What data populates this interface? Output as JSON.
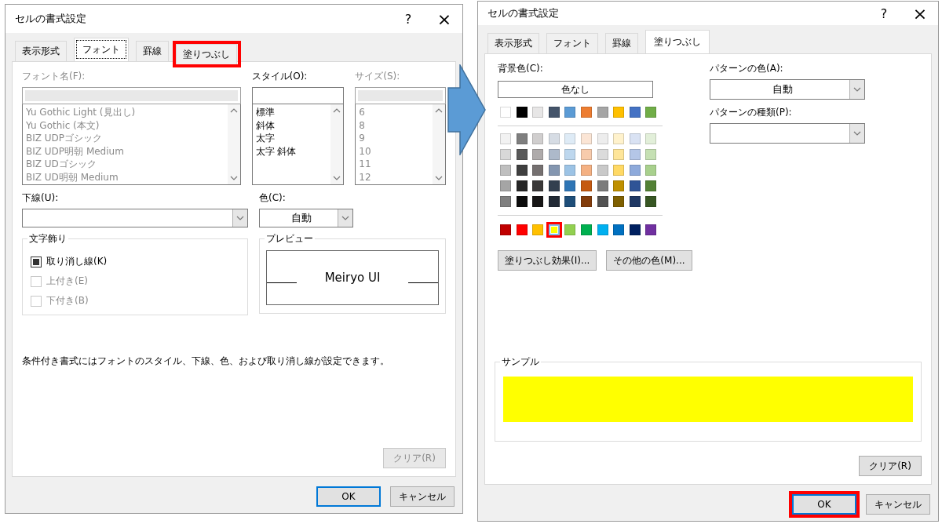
{
  "left_dialog": {
    "title": "セルの書式設定",
    "help": "?",
    "close": "×",
    "tabs": [
      {
        "label": "表示形式",
        "selected": false,
        "highlighted": false
      },
      {
        "label": "フォント",
        "selected": true,
        "highlighted": false
      },
      {
        "label": "罫線",
        "selected": false,
        "highlighted": false
      },
      {
        "label": "塗りつぶし",
        "selected": false,
        "highlighted": true
      }
    ],
    "font_name": {
      "label": "フォント名(F):",
      "disabled": true,
      "items": [
        "Yu Gothic Light (見出し)",
        "Yu Gothic (本文)",
        "BIZ UDPゴシック",
        "BIZ UDP明朝 Medium",
        "BIZ UDゴシック",
        "BIZ UD明朝 Medium"
      ]
    },
    "style": {
      "label": "スタイル(O):",
      "disabled": false,
      "items": [
        "標準",
        "斜体",
        "太字",
        "太字 斜体"
      ]
    },
    "size": {
      "label": "サイズ(S):",
      "disabled": true,
      "items": [
        "6",
        "8",
        "9",
        "10",
        "11",
        "12"
      ]
    },
    "underline": {
      "label": "下線(U):"
    },
    "color": {
      "label": "色(C):",
      "value": "自動"
    },
    "effects": {
      "title": "文字飾り",
      "checkboxes": [
        {
          "label": "取り消し線(K)",
          "checked": true,
          "disabled": false
        },
        {
          "label": "上付き(E)",
          "checked": false,
          "disabled": true
        },
        {
          "label": "下付き(B)",
          "checked": false,
          "disabled": true
        }
      ]
    },
    "preview": {
      "title": "プレビュー",
      "text": "Meiryo UI"
    },
    "note": "条件付き書式にはフォントのスタイル、下線、色、および取り消し線が設定できます。",
    "clear_button": {
      "label": "クリア(R)",
      "disabled": true
    },
    "buttons": [
      {
        "label": "OK",
        "default": true,
        "highlighted": false
      },
      {
        "label": "キャンセル",
        "default": false,
        "highlighted": false
      }
    ]
  },
  "right_dialog": {
    "title": "セルの書式設定",
    "help": "?",
    "close": "×",
    "tabs": [
      {
        "label": "表示形式",
        "selected": false,
        "highlighted": false
      },
      {
        "label": "フォント",
        "selected": false,
        "highlighted": false
      },
      {
        "label": "罫線",
        "selected": false,
        "highlighted": false
      },
      {
        "label": "塗りつぶし",
        "selected": true,
        "highlighted": false
      }
    ],
    "background_label": "背景色(C):",
    "no_color": "色なし",
    "theme_colors": [
      {
        "color": "#ffffff",
        "selected": false
      },
      {
        "color": "#000000",
        "selected": false
      },
      {
        "color": "#e7e6e6",
        "selected": false
      },
      {
        "color": "#44546a",
        "selected": false
      },
      {
        "color": "#5b9bd5",
        "selected": false
      },
      {
        "color": "#ed7d31",
        "selected": false
      },
      {
        "color": "#a5a5a5",
        "selected": false
      },
      {
        "color": "#ffc000",
        "selected": false
      },
      {
        "color": "#4472c4",
        "selected": false
      },
      {
        "color": "#70ad47",
        "selected": false
      }
    ],
    "shades": [
      [
        {
          "color": "#f2f2f2",
          "selected": false
        },
        {
          "color": "#7f7f7f",
          "selected": false
        },
        {
          "color": "#d0cece",
          "selected": false
        },
        {
          "color": "#d6dce4",
          "selected": false
        },
        {
          "color": "#deebf6",
          "selected": false
        },
        {
          "color": "#fbe5d5",
          "selected": false
        },
        {
          "color": "#ededed",
          "selected": false
        },
        {
          "color": "#fff2cc",
          "selected": false
        },
        {
          "color": "#d9e2f3",
          "selected": false
        },
        {
          "color": "#e2efd9",
          "selected": false
        }
      ],
      [
        {
          "color": "#d8d8d8",
          "selected": false
        },
        {
          "color": "#595959",
          "selected": false
        },
        {
          "color": "#aeaaaa",
          "selected": false
        },
        {
          "color": "#adb9ca",
          "selected": false
        },
        {
          "color": "#bdd7ee",
          "selected": false
        },
        {
          "color": "#f7cbac",
          "selected": false
        },
        {
          "color": "#dbdbdb",
          "selected": false
        },
        {
          "color": "#fee599",
          "selected": false
        },
        {
          "color": "#b4c6e7",
          "selected": false
        },
        {
          "color": "#c5e0b3",
          "selected": false
        }
      ],
      [
        {
          "color": "#bfbfbf",
          "selected": false
        },
        {
          "color": "#3f3f3f",
          "selected": false
        },
        {
          "color": "#757070",
          "selected": false
        },
        {
          "color": "#8496b0",
          "selected": false
        },
        {
          "color": "#9cc3e5",
          "selected": false
        },
        {
          "color": "#f4b183",
          "selected": false
        },
        {
          "color": "#c9c9c9",
          "selected": false
        },
        {
          "color": "#ffd965",
          "selected": false
        },
        {
          "color": "#8eaadb",
          "selected": false
        },
        {
          "color": "#a8d08d",
          "selected": false
        }
      ],
      [
        {
          "color": "#a5a5a5",
          "selected": false
        },
        {
          "color": "#262626",
          "selected": false
        },
        {
          "color": "#3a3838",
          "selected": false
        },
        {
          "color": "#323f4f",
          "selected": false
        },
        {
          "color": "#2e75b5",
          "selected": false
        },
        {
          "color": "#c55a11",
          "selected": false
        },
        {
          "color": "#7b7b7b",
          "selected": false
        },
        {
          "color": "#bf9000",
          "selected": false
        },
        {
          "color": "#2f5496",
          "selected": false
        },
        {
          "color": "#538135",
          "selected": false
        }
      ],
      [
        {
          "color": "#7f7f7f",
          "selected": false
        },
        {
          "color": "#0c0c0c",
          "selected": false
        },
        {
          "color": "#171616",
          "selected": false
        },
        {
          "color": "#222a35",
          "selected": false
        },
        {
          "color": "#1e4e79",
          "selected": false
        },
        {
          "color": "#833c0b",
          "selected": false
        },
        {
          "color": "#525252",
          "selected": false
        },
        {
          "color": "#7f6000",
          "selected": false
        },
        {
          "color": "#1f3864",
          "selected": false
        },
        {
          "color": "#375623",
          "selected": false
        }
      ]
    ],
    "standard_colors": [
      {
        "color": "#c00000",
        "selected": false,
        "highlighted": false
      },
      {
        "color": "#ff0000",
        "selected": false,
        "highlighted": false
      },
      {
        "color": "#ffc000",
        "selected": false,
        "highlighted": false
      },
      {
        "color": "#ffff00",
        "selected": true,
        "highlighted": true
      },
      {
        "color": "#92d050",
        "selected": false,
        "highlighted": false
      },
      {
        "color": "#00b050",
        "selected": false,
        "highlighted": false
      },
      {
        "color": "#00b0f0",
        "selected": false,
        "highlighted": false
      },
      {
        "color": "#0070c0",
        "selected": false,
        "highlighted": false
      },
      {
        "color": "#002060",
        "selected": false,
        "highlighted": false
      },
      {
        "color": "#7030a0",
        "selected": false,
        "highlighted": false
      }
    ],
    "fill_effects_button": "塗りつぶし効果(I)...",
    "more_colors_button": "その他の色(M)...",
    "pattern_color": {
      "label": "パターンの色(A):",
      "value": "自動"
    },
    "pattern_type": {
      "label": "パターンの種類(P):"
    },
    "sample": {
      "title": "サンプル",
      "color": "#ffff00"
    },
    "clear_button": {
      "label": "クリア(R)",
      "disabled": false
    },
    "buttons": [
      {
        "label": "OK",
        "default": true,
        "highlighted": true
      },
      {
        "label": "キャンセル",
        "default": false,
        "highlighted": false
      }
    ]
  }
}
